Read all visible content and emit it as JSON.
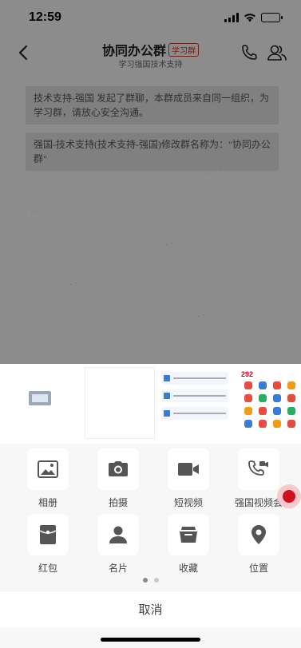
{
  "status": {
    "time": "12:59"
  },
  "header": {
    "title": "协同办公群",
    "tag": "学习群",
    "subtitle": "学习强国技术支持"
  },
  "messages": [
    "技术支持-强国 发起了群聊，本群成员来自同一组织，为学习群，请放心安全沟通。",
    "强国-技术支持(技术支持-强国)修改群名称为：\"协同办公群\""
  ],
  "sheet": {
    "apps_row1": [
      {
        "label": "相册",
        "icon": "photo-icon"
      },
      {
        "label": "拍摄",
        "icon": "camera-icon"
      },
      {
        "label": "短视频",
        "icon": "video-icon"
      },
      {
        "label": "强国视频会",
        "icon": "video-call-icon"
      }
    ],
    "apps_row2": [
      {
        "label": "红包",
        "icon": "red-packet-icon"
      },
      {
        "label": "名片",
        "icon": "contact-card-icon"
      },
      {
        "label": "收藏",
        "icon": "favorites-icon"
      },
      {
        "label": "位置",
        "icon": "location-icon"
      }
    ],
    "thumb4_number": "292",
    "cancel": "取消",
    "page_count": 2,
    "page_active": 0
  },
  "colors": {
    "accent_red": "#d0101d",
    "icon_gray": "#555555"
  }
}
